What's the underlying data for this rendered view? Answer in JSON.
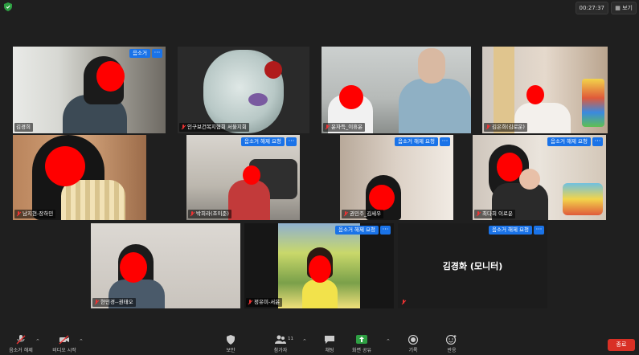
{
  "topbar": {
    "timer": "00:27:37",
    "view_label": "보기"
  },
  "controls": {
    "request_unmute": "음소거 해제 요청",
    "mute": "음소거",
    "more": "···"
  },
  "participants": [
    {
      "name": "김경희",
      "button": "음소거"
    },
    {
      "name": "인구보건복지협회 서울지회"
    },
    {
      "name": "윤자득_이휴윤"
    },
    {
      "name": "김은희(김로운)"
    },
    {
      "name": "남지현-장하민"
    },
    {
      "name": "박희라(조이준)",
      "button": "음소거 해제 요청"
    },
    {
      "name": "권민주_김세우",
      "button": "음소거 해제 요청"
    },
    {
      "name": "최다희 이로운",
      "button": "음소거 해제 요청"
    },
    {
      "name": "현민경--권태오"
    },
    {
      "name": "정유미-서윤",
      "button": "음소거 해제 요청"
    },
    {
      "name": "김경화 (모니터)",
      "button": "음소거 해제 요청"
    }
  ],
  "toolbar": {
    "unmute": "음소거 해제",
    "video_start": "비디오 시작",
    "security": "보안",
    "participants": "참가자",
    "participants_count": "11",
    "chat": "채팅",
    "share_screen": "화면 공유",
    "record": "기록",
    "reactions": "반응",
    "end": "종료"
  },
  "colors": {
    "accent_blue": "#1a73e8",
    "active_speaker": "#c9e04b",
    "end_red": "#d93025",
    "share_green": "#2ea043"
  }
}
